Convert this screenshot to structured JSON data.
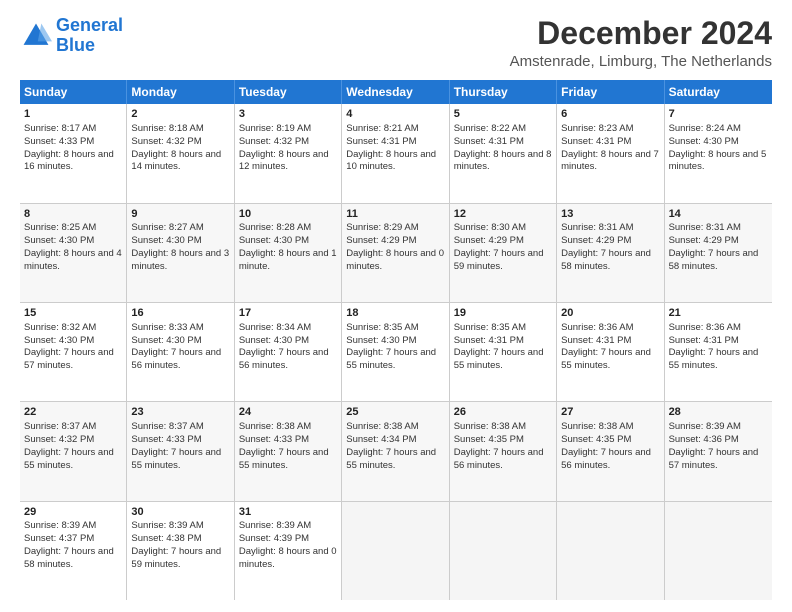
{
  "logo": {
    "line1": "General",
    "line2": "Blue"
  },
  "title": "December 2024",
  "subtitle": "Amstenrade, Limburg, The Netherlands",
  "header_days": [
    "Sunday",
    "Monday",
    "Tuesday",
    "Wednesday",
    "Thursday",
    "Friday",
    "Saturday"
  ],
  "weeks": [
    [
      {
        "day": "1",
        "sunrise": "Sunrise: 8:17 AM",
        "sunset": "Sunset: 4:33 PM",
        "daylight": "Daylight: 8 hours and 16 minutes."
      },
      {
        "day": "2",
        "sunrise": "Sunrise: 8:18 AM",
        "sunset": "Sunset: 4:32 PM",
        "daylight": "Daylight: 8 hours and 14 minutes."
      },
      {
        "day": "3",
        "sunrise": "Sunrise: 8:19 AM",
        "sunset": "Sunset: 4:32 PM",
        "daylight": "Daylight: 8 hours and 12 minutes."
      },
      {
        "day": "4",
        "sunrise": "Sunrise: 8:21 AM",
        "sunset": "Sunset: 4:31 PM",
        "daylight": "Daylight: 8 hours and 10 minutes."
      },
      {
        "day": "5",
        "sunrise": "Sunrise: 8:22 AM",
        "sunset": "Sunset: 4:31 PM",
        "daylight": "Daylight: 8 hours and 8 minutes."
      },
      {
        "day": "6",
        "sunrise": "Sunrise: 8:23 AM",
        "sunset": "Sunset: 4:31 PM",
        "daylight": "Daylight: 8 hours and 7 minutes."
      },
      {
        "day": "7",
        "sunrise": "Sunrise: 8:24 AM",
        "sunset": "Sunset: 4:30 PM",
        "daylight": "Daylight: 8 hours and 5 minutes."
      }
    ],
    [
      {
        "day": "8",
        "sunrise": "Sunrise: 8:25 AM",
        "sunset": "Sunset: 4:30 PM",
        "daylight": "Daylight: 8 hours and 4 minutes."
      },
      {
        "day": "9",
        "sunrise": "Sunrise: 8:27 AM",
        "sunset": "Sunset: 4:30 PM",
        "daylight": "Daylight: 8 hours and 3 minutes."
      },
      {
        "day": "10",
        "sunrise": "Sunrise: 8:28 AM",
        "sunset": "Sunset: 4:30 PM",
        "daylight": "Daylight: 8 hours and 1 minute."
      },
      {
        "day": "11",
        "sunrise": "Sunrise: 8:29 AM",
        "sunset": "Sunset: 4:29 PM",
        "daylight": "Daylight: 8 hours and 0 minutes."
      },
      {
        "day": "12",
        "sunrise": "Sunrise: 8:30 AM",
        "sunset": "Sunset: 4:29 PM",
        "daylight": "Daylight: 7 hours and 59 minutes."
      },
      {
        "day": "13",
        "sunrise": "Sunrise: 8:31 AM",
        "sunset": "Sunset: 4:29 PM",
        "daylight": "Daylight: 7 hours and 58 minutes."
      },
      {
        "day": "14",
        "sunrise": "Sunrise: 8:31 AM",
        "sunset": "Sunset: 4:29 PM",
        "daylight": "Daylight: 7 hours and 58 minutes."
      }
    ],
    [
      {
        "day": "15",
        "sunrise": "Sunrise: 8:32 AM",
        "sunset": "Sunset: 4:30 PM",
        "daylight": "Daylight: 7 hours and 57 minutes."
      },
      {
        "day": "16",
        "sunrise": "Sunrise: 8:33 AM",
        "sunset": "Sunset: 4:30 PM",
        "daylight": "Daylight: 7 hours and 56 minutes."
      },
      {
        "day": "17",
        "sunrise": "Sunrise: 8:34 AM",
        "sunset": "Sunset: 4:30 PM",
        "daylight": "Daylight: 7 hours and 56 minutes."
      },
      {
        "day": "18",
        "sunrise": "Sunrise: 8:35 AM",
        "sunset": "Sunset: 4:30 PM",
        "daylight": "Daylight: 7 hours and 55 minutes."
      },
      {
        "day": "19",
        "sunrise": "Sunrise: 8:35 AM",
        "sunset": "Sunset: 4:31 PM",
        "daylight": "Daylight: 7 hours and 55 minutes."
      },
      {
        "day": "20",
        "sunrise": "Sunrise: 8:36 AM",
        "sunset": "Sunset: 4:31 PM",
        "daylight": "Daylight: 7 hours and 55 minutes."
      },
      {
        "day": "21",
        "sunrise": "Sunrise: 8:36 AM",
        "sunset": "Sunset: 4:31 PM",
        "daylight": "Daylight: 7 hours and 55 minutes."
      }
    ],
    [
      {
        "day": "22",
        "sunrise": "Sunrise: 8:37 AM",
        "sunset": "Sunset: 4:32 PM",
        "daylight": "Daylight: 7 hours and 55 minutes."
      },
      {
        "day": "23",
        "sunrise": "Sunrise: 8:37 AM",
        "sunset": "Sunset: 4:33 PM",
        "daylight": "Daylight: 7 hours and 55 minutes."
      },
      {
        "day": "24",
        "sunrise": "Sunrise: 8:38 AM",
        "sunset": "Sunset: 4:33 PM",
        "daylight": "Daylight: 7 hours and 55 minutes."
      },
      {
        "day": "25",
        "sunrise": "Sunrise: 8:38 AM",
        "sunset": "Sunset: 4:34 PM",
        "daylight": "Daylight: 7 hours and 55 minutes."
      },
      {
        "day": "26",
        "sunrise": "Sunrise: 8:38 AM",
        "sunset": "Sunset: 4:35 PM",
        "daylight": "Daylight: 7 hours and 56 minutes."
      },
      {
        "day": "27",
        "sunrise": "Sunrise: 8:38 AM",
        "sunset": "Sunset: 4:35 PM",
        "daylight": "Daylight: 7 hours and 56 minutes."
      },
      {
        "day": "28",
        "sunrise": "Sunrise: 8:39 AM",
        "sunset": "Sunset: 4:36 PM",
        "daylight": "Daylight: 7 hours and 57 minutes."
      }
    ],
    [
      {
        "day": "29",
        "sunrise": "Sunrise: 8:39 AM",
        "sunset": "Sunset: 4:37 PM",
        "daylight": "Daylight: 7 hours and 58 minutes."
      },
      {
        "day": "30",
        "sunrise": "Sunrise: 8:39 AM",
        "sunset": "Sunset: 4:38 PM",
        "daylight": "Daylight: 7 hours and 59 minutes."
      },
      {
        "day": "31",
        "sunrise": "Sunrise: 8:39 AM",
        "sunset": "Sunset: 4:39 PM",
        "daylight": "Daylight: 8 hours and 0 minutes."
      },
      null,
      null,
      null,
      null
    ]
  ]
}
